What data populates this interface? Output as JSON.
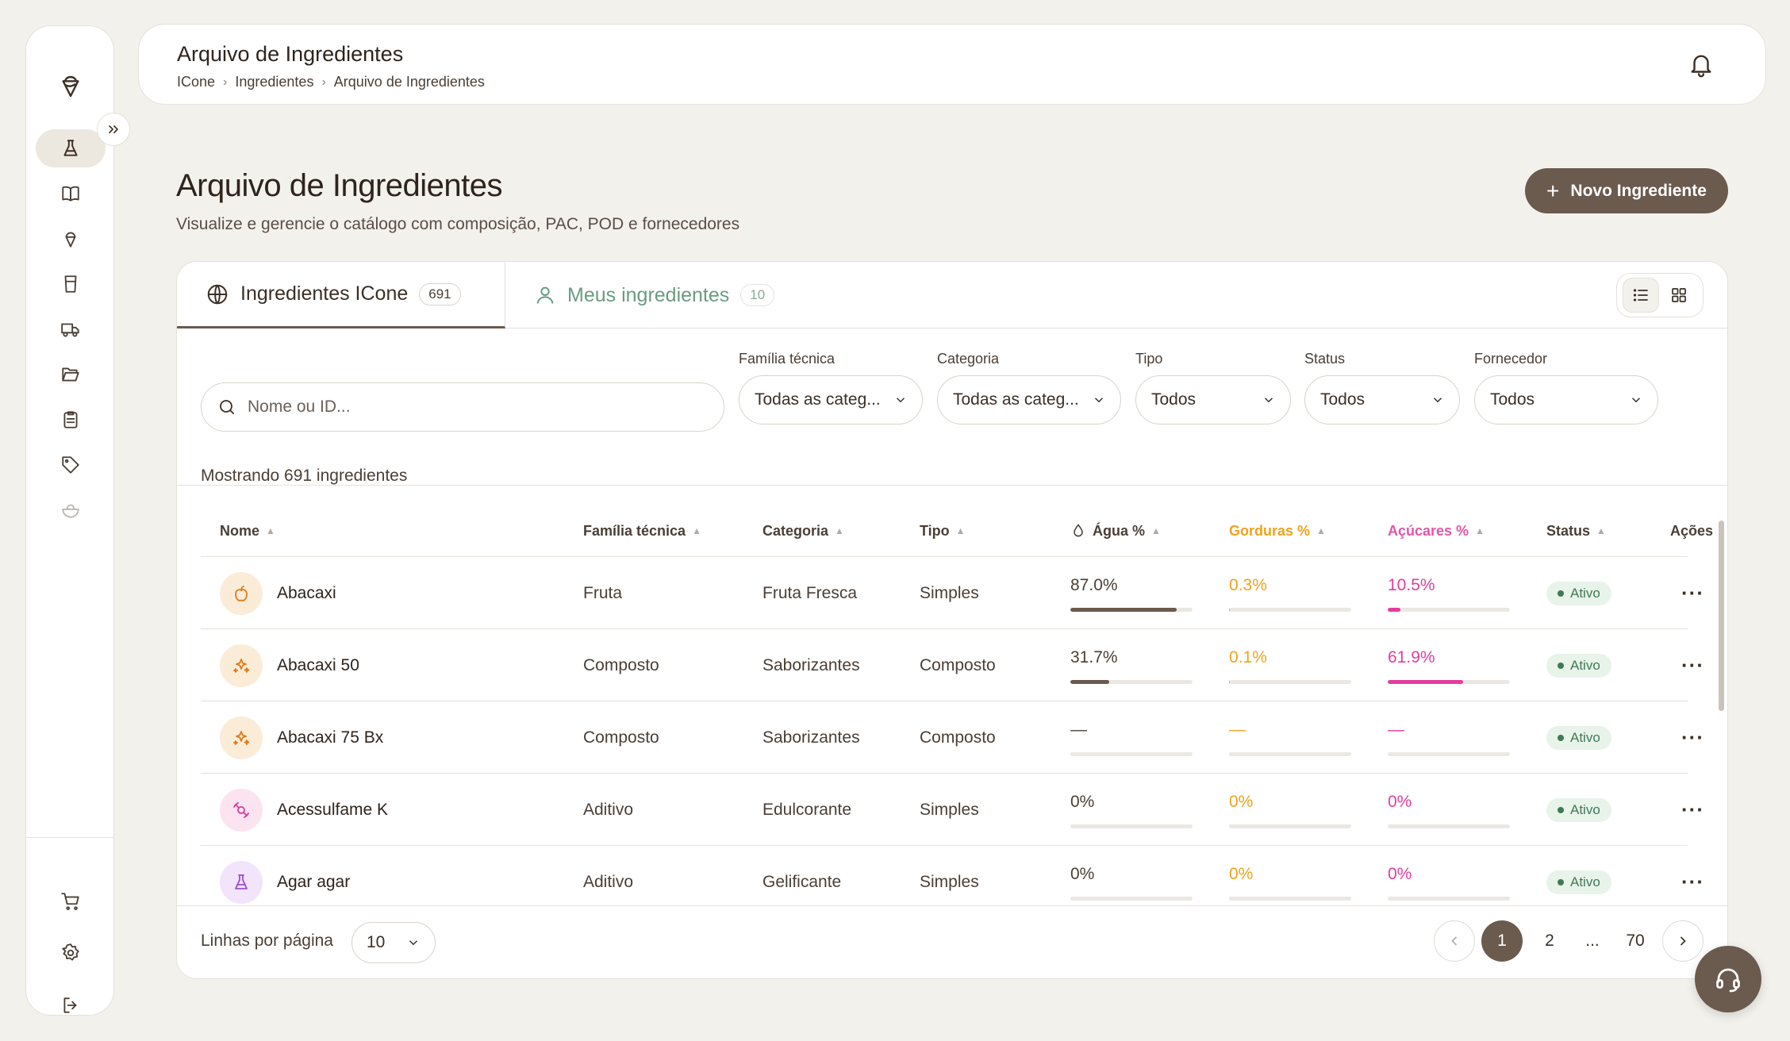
{
  "header": {
    "title": "Arquivo de Ingredientes",
    "breadcrumb": [
      "ICone",
      "Ingredientes",
      "Arquivo de Ingredientes"
    ]
  },
  "page": {
    "title": "Arquivo de Ingredientes",
    "subtitle": "Visualize e gerencie o catálogo com composição, PAC, POD e fornecedores",
    "new_button": "Novo Ingrediente"
  },
  "tabs": [
    {
      "label": "Ingredientes ICone",
      "count": "691"
    },
    {
      "label": "Meus ingredientes",
      "count": "10"
    }
  ],
  "filters": {
    "search_placeholder": "Nome ou ID...",
    "familia": {
      "label": "Família técnica",
      "value": "Todas as categ..."
    },
    "categoria": {
      "label": "Categoria",
      "value": "Todas as categ..."
    },
    "tipo": {
      "label": "Tipo",
      "value": "Todos"
    },
    "status": {
      "label": "Status",
      "value": "Todos"
    },
    "fornecedor": {
      "label": "Fornecedor",
      "value": "Todos"
    }
  },
  "showing_text": "Mostrando 691 ingredientes",
  "table": {
    "columns": {
      "nome": "Nome",
      "familia": "Família técnica",
      "categoria": "Categoria",
      "tipo": "Tipo",
      "agua": "Água %",
      "gorduras": "Gorduras %",
      "acucares": "Açúcares %",
      "status": "Status",
      "acoes": "Ações"
    },
    "rows": [
      {
        "nome": "Abacaxi",
        "familia": "Fruta",
        "categoria": "Fruta Fresca",
        "tipo": "Simples",
        "agua": "87.0%",
        "agua_pct": 87,
        "gorduras": "0.3%",
        "gorduras_pct": 0.3,
        "acucares": "10.5%",
        "acucares_pct": 10.5,
        "status": "Ativo",
        "icon": "apple-icon"
      },
      {
        "nome": "Abacaxi 50",
        "familia": "Composto",
        "categoria": "Saborizantes",
        "tipo": "Composto",
        "agua": "31.7%",
        "agua_pct": 31.7,
        "gorduras": "0.1%",
        "gorduras_pct": 0.1,
        "acucares": "61.9%",
        "acucares_pct": 61.9,
        "status": "Ativo",
        "icon": "sparkles-icon"
      },
      {
        "nome": "Abacaxi 75 Bx",
        "familia": "Composto",
        "categoria": "Saborizantes",
        "tipo": "Composto",
        "agua": "—",
        "agua_pct": 0,
        "gorduras": "—",
        "gorduras_pct": 0,
        "acucares": "—",
        "acucares_pct": 0,
        "status": "Ativo",
        "icon": "sparkles-icon"
      },
      {
        "nome": "Acessulfame K",
        "familia": "Aditivo",
        "categoria": "Edulcorante",
        "tipo": "Simples",
        "agua": "0%",
        "agua_pct": 0,
        "gorduras": "0%",
        "gorduras_pct": 0,
        "acucares": "0%",
        "acucares_pct": 0,
        "status": "Ativo",
        "icon": "candy-icon"
      },
      {
        "nome": "Agar agar",
        "familia": "Aditivo",
        "categoria": "Gelificante",
        "tipo": "Simples",
        "agua": "0%",
        "agua_pct": 0,
        "gorduras": "0%",
        "gorduras_pct": 0,
        "acucares": "0%",
        "acucares_pct": 0,
        "status": "Ativo",
        "icon": "flask-icon"
      }
    ]
  },
  "pagination": {
    "rows_label": "Linhas por página",
    "rows_value": "10",
    "pages": [
      "1",
      "2",
      "...",
      "70"
    ],
    "current": "1"
  },
  "colors": {
    "accent": "#6b5a4e",
    "water": "#6b5a4e",
    "fat": "#f0a21c",
    "sugar": "#e43d9e",
    "status_active": "#3f7a55"
  }
}
